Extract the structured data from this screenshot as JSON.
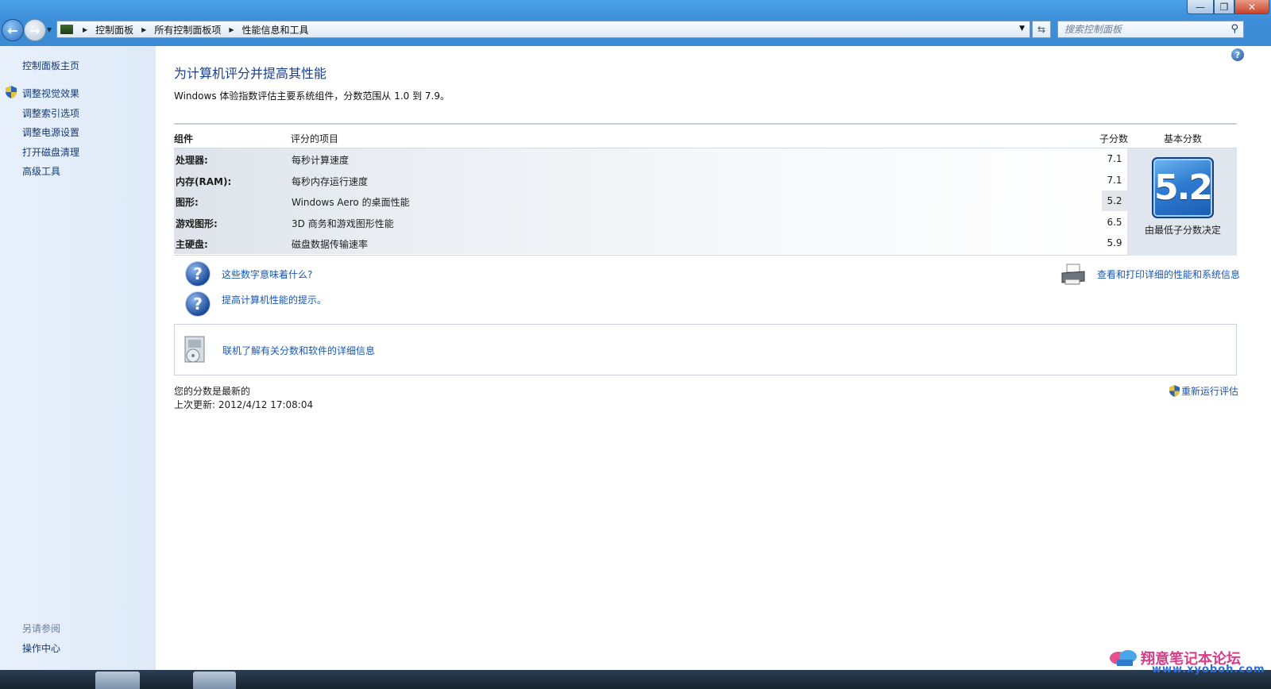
{
  "window": {
    "minimize_label": "—",
    "maximize_label": "❐",
    "close_label": "✕"
  },
  "address": {
    "crumbs": [
      "控制面板",
      "所有控制面板项",
      "性能信息和工具"
    ],
    "search_placeholder": "搜索控制面板"
  },
  "sidebar": {
    "home": "控制面板主页",
    "links": [
      "调整视觉效果",
      "调整索引选项",
      "调整电源设置",
      "打开磁盘清理",
      "高级工具"
    ],
    "see_also": "另请参阅",
    "see_also_link": "操作中心"
  },
  "main": {
    "title": "为计算机评分并提高其性能",
    "description": "Windows 体验指数评估主要系统组件，分数范围从 1.0 到 7.9。",
    "table": {
      "headers": {
        "component": "组件",
        "rated_item": "评分的项目",
        "subscore": "子分数",
        "base_score": "基本分数"
      },
      "rows": [
        {
          "component": "处理器:",
          "item": "每秒计算速度",
          "score": "7.1"
        },
        {
          "component": "内存(RAM):",
          "item": "每秒内存运行速度",
          "score": "7.1"
        },
        {
          "component": "图形:",
          "item": "Windows Aero 的桌面性能",
          "score": "5.2"
        },
        {
          "component": "游戏图形:",
          "item": "3D 商务和游戏图形性能",
          "score": "6.5"
        },
        {
          "component": "主硬盘:",
          "item": "磁盘数据传输速率",
          "score": "5.9"
        }
      ],
      "base_score": "5.2",
      "base_note": "由最低子分数决定"
    },
    "links": {
      "what_mean": "这些数字意味着什么?",
      "tips": "提高计算机性能的提示。",
      "print": "查看和打印详细的性能和系统信息",
      "online": "联机了解有关分数和软件的详细信息",
      "rerun": "重新运行评估"
    },
    "status": {
      "current": "您的分数是最新的",
      "last_update": "上次更新: 2012/4/12 17:08:04"
    }
  },
  "watermark": {
    "text": "翔意笔记本论坛",
    "url": "www.xyoboh.com"
  },
  "colors": {
    "link": "#1857b5",
    "title": "#1a3e8c",
    "badge": "#2f7bd0",
    "sidebar_bg": "#e3edf9"
  }
}
